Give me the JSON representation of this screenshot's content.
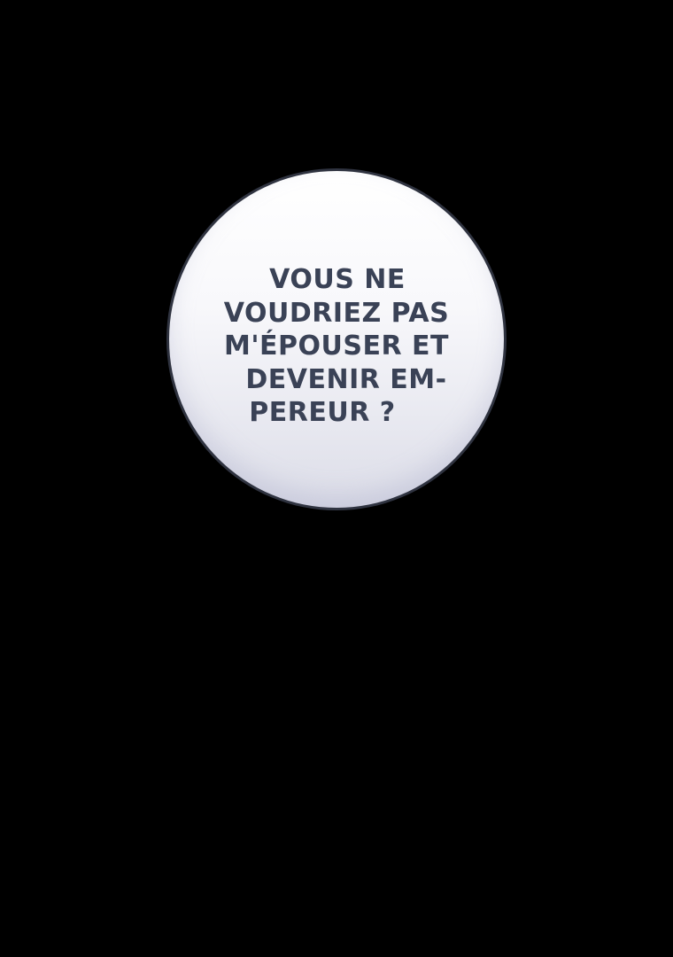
{
  "bubble": {
    "lines": [
      "VOUS NE",
      "VOUDRIEZ PAS",
      "M'ÉPOUSER ET",
      "DEVENIR EM-",
      "PEREUR ?"
    ]
  },
  "colors": {
    "background": "#000000",
    "bubble_outline": "#2f3340",
    "text": "#3a4256"
  }
}
